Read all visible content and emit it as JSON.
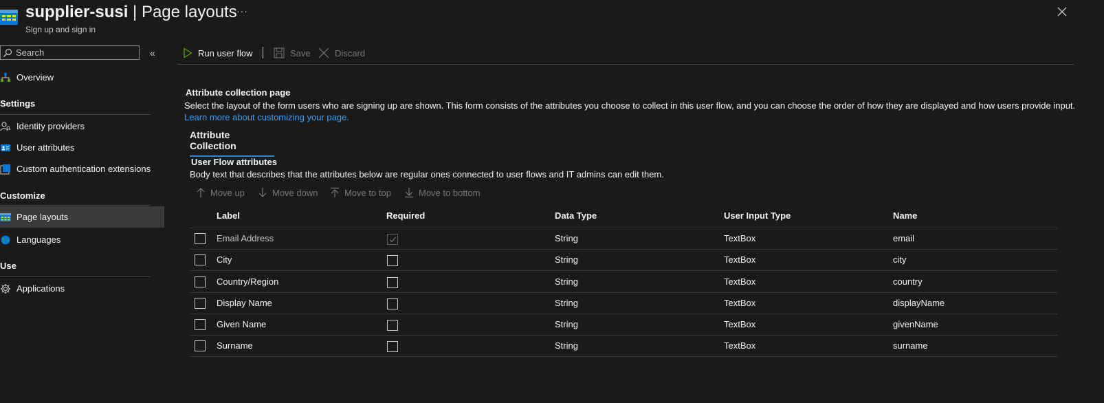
{
  "header": {
    "title_bold": "supplier-susi",
    "title_rest": " | Page layouts",
    "subtitle": "Sign up and sign in",
    "more_label": "···"
  },
  "sidebar": {
    "search_placeholder": "Search",
    "collapse_label": "«",
    "overview": "Overview",
    "sections": {
      "settings": "Settings",
      "customize": "Customize",
      "use": "Use"
    },
    "items": {
      "identity_providers": "Identity providers",
      "user_attributes": "User attributes",
      "custom_auth_ext": "Custom authentication extensions",
      "page_layouts": "Page layouts",
      "languages": "Languages",
      "applications": "Applications"
    }
  },
  "toolbar": {
    "run": "Run user flow",
    "save": "Save",
    "discard": "Discard"
  },
  "main": {
    "section_title": "Attribute collection page",
    "description": "Select the layout of the form users who are signing up are shown. This form consists of the attributes you choose to collect in this user flow, and you can choose the order of how they are displayed and how users provide input.",
    "learn_more": "Learn more about customizing your page.",
    "tab": "Attribute Collection",
    "sub_title": "User Flow attributes",
    "sub_description": "Body text that describes that the attributes below are regular ones connected to user flows and IT admins can edit them.",
    "move": {
      "up": "Move up",
      "down": "Move down",
      "top": "Move to top",
      "bottom": "Move to bottom"
    }
  },
  "table": {
    "columns": {
      "label": "Label",
      "required": "Required",
      "data_type": "Data Type",
      "input_type": "User Input Type",
      "name": "Name"
    },
    "rows": [
      {
        "label": "Email Address",
        "required": true,
        "required_locked": true,
        "data_type": "String",
        "input_type": "TextBox",
        "name": "email"
      },
      {
        "label": "City",
        "required": false,
        "data_type": "String",
        "input_type": "TextBox",
        "name": "city"
      },
      {
        "label": "Country/Region",
        "required": false,
        "data_type": "String",
        "input_type": "TextBox",
        "name": "country"
      },
      {
        "label": "Display Name",
        "required": false,
        "data_type": "String",
        "input_type": "TextBox",
        "name": "displayName"
      },
      {
        "label": "Given Name",
        "required": false,
        "data_type": "String",
        "input_type": "TextBox",
        "name": "givenName"
      },
      {
        "label": "Surname",
        "required": false,
        "data_type": "String",
        "input_type": "TextBox",
        "name": "surname"
      }
    ]
  },
  "colors": {
    "background": "#1b1a19",
    "accent": "#2b88d8",
    "link": "#3aa0f3",
    "run_icon": "#57a300"
  },
  "icons": {
    "app": "page-layout-icon",
    "search": "search-icon",
    "close": "close-icon",
    "run": "play-icon",
    "save": "save-icon",
    "discard": "discard-icon"
  }
}
